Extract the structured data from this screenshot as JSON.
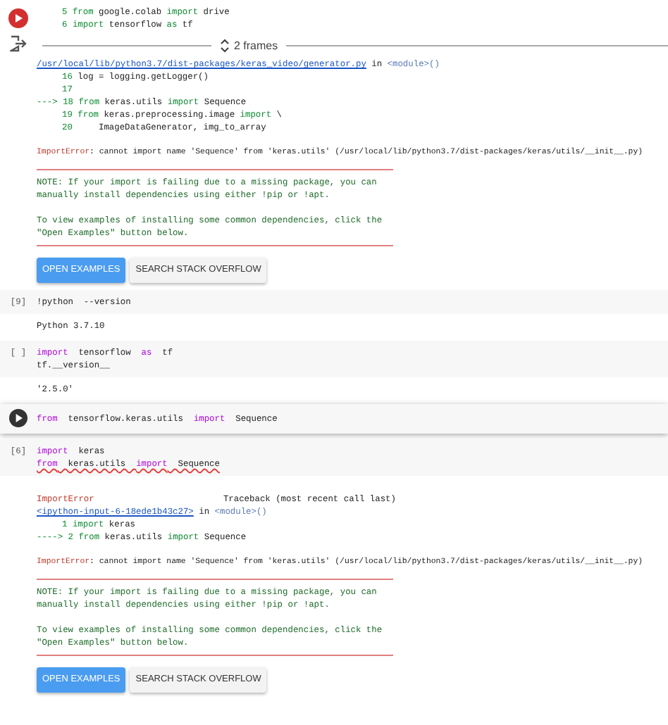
{
  "cells": [
    {
      "kind": "continued",
      "error": true,
      "outputs": [
        {
          "kind": "traceback_lines",
          "lines": [
            {
              "number": "5",
              "tokens": [
                {
                  "text": "from",
                  "kind": "keyword"
                },
                {
                  "text": " google.colab ",
                  "kind": "plain"
                },
                {
                  "text": "import",
                  "kind": "keyword"
                },
                {
                  "text": " drive",
                  "kind": "plain"
                }
              ]
            },
            {
              "number": "6",
              "tokens": [
                {
                  "text": "import",
                  "kind": "keyword"
                },
                {
                  "text": " tensorflow ",
                  "kind": "plain"
                },
                {
                  "text": "as",
                  "kind": "keyword"
                },
                {
                  "text": " tf",
                  "kind": "plain"
                }
              ]
            }
          ]
        },
        {
          "kind": "frames_divider",
          "label": "2 frames"
        },
        {
          "kind": "frame_header",
          "link": "/usr/local/lib/python3.7/dist-packages/keras_video/generator.py",
          "middle": " in ",
          "module": "<module>()"
        },
        {
          "kind": "traceback_lines",
          "lines": [
            {
              "number": "16",
              "tokens": [
                {
                  "text": "log = logging.getLogger()",
                  "kind": "plain"
                }
              ]
            },
            {
              "number": "17"
            },
            {
              "arrow": "--->",
              "number": "18",
              "tokens": [
                {
                  "text": "from",
                  "kind": "keyword"
                },
                {
                  "text": " keras.utils ",
                  "kind": "plain"
                },
                {
                  "text": "import",
                  "kind": "keyword"
                },
                {
                  "text": " Sequence",
                  "kind": "plain"
                }
              ]
            },
            {
              "number": "19",
              "tokens": [
                {
                  "text": "from",
                  "kind": "keyword"
                },
                {
                  "text": " keras.preprocessing.image ",
                  "kind": "plain"
                },
                {
                  "text": "import",
                  "kind": "keyword"
                },
                {
                  "text": " \\",
                  "kind": "plain"
                }
              ]
            },
            {
              "number": "20",
              "tokens": [
                {
                  "text": "    ImageDataGenerator, img_to_array",
                  "kind": "plain"
                }
              ]
            }
          ]
        },
        {
          "kind": "error_line",
          "name": "ImportError",
          "message": ": cannot import name 'Sequence' from 'keras.utils' (/usr/local/lib/python3.7/dist-packages/keras/utils/__init__.py)"
        },
        {
          "kind": "note",
          "paragraphs": [
            [
              "NOTE: If your import is failing due to a missing package, you can",
              "manually install dependencies using either !pip or !apt."
            ],
            [
              "To view examples of installing some common dependencies, click the",
              "\"Open Examples\" button below."
            ]
          ]
        },
        {
          "kind": "buttons",
          "buttons": [
            {
              "label": "OPEN EXAMPLES",
              "kind": "primary"
            },
            {
              "label": "SEARCH STACK OVERFLOW",
              "kind": "secondary"
            }
          ]
        }
      ]
    },
    {
      "kind": "code",
      "prompt": "[9]",
      "focused": false,
      "lines": [
        {
          "underlined": false,
          "tokens": [
            {
              "text": "!python  --version",
              "kind": "plain"
            }
          ]
        }
      ],
      "outputs": [
        {
          "kind": "text",
          "lines": [
            "Python 3.7.10"
          ]
        }
      ]
    },
    {
      "kind": "code",
      "prompt": "[ ]",
      "focused": false,
      "lines": [
        {
          "underlined": false,
          "tokens": [
            {
              "text": "import",
              "kind": "keyword"
            },
            {
              "text": "  tensorflow  ",
              "kind": "plain"
            },
            {
              "text": "as",
              "kind": "keyword"
            },
            {
              "text": "  tf",
              "kind": "plain"
            }
          ]
        },
        {
          "underlined": false,
          "tokens": [
            {
              "text": "tf.__version__",
              "kind": "plain"
            }
          ]
        }
      ],
      "outputs": [
        {
          "kind": "text",
          "lines": [
            "'2.5.0'"
          ]
        }
      ]
    },
    {
      "kind": "code",
      "focused": true,
      "lines": [
        {
          "underlined": false,
          "tokens": [
            {
              "text": "from",
              "kind": "keyword"
            },
            {
              "text": "  tensorflow.keras.utils  ",
              "kind": "plain"
            },
            {
              "text": "import",
              "kind": "keyword"
            },
            {
              "text": "  Sequence",
              "kind": "plain"
            }
          ]
        }
      ]
    },
    {
      "kind": "code",
      "prompt": "[6]",
      "focused": false,
      "lines": [
        {
          "underlined": false,
          "tokens": [
            {
              "text": "import",
              "kind": "keyword"
            },
            {
              "text": "  keras",
              "kind": "plain"
            }
          ]
        },
        {
          "underlined": true,
          "tokens": [
            {
              "text": "from",
              "kind": "keyword"
            },
            {
              "text": "  keras.utils  ",
              "kind": "plain"
            },
            {
              "text": "import",
              "kind": "keyword"
            },
            {
              "text": "  Sequence",
              "kind": "plain"
            }
          ]
        }
      ],
      "outputs": [
        {
          "kind": "traceback_title",
          "name": "ImportError",
          "title": "Traceback (most recent call last)"
        },
        {
          "kind": "frame_header",
          "link": "<ipython-input-6-18ede1b43c27>",
          "middle": " in ",
          "module": "<module>()"
        },
        {
          "kind": "traceback_lines",
          "lines": [
            {
              "number": "1",
              "tokens": [
                {
                  "text": "import",
                  "kind": "keyword"
                },
                {
                  "text": " keras",
                  "kind": "plain"
                }
              ]
            },
            {
              "arrow": "---->",
              "number": "2",
              "tokens": [
                {
                  "text": "from",
                  "kind": "keyword"
                },
                {
                  "text": " keras.utils ",
                  "kind": "plain"
                },
                {
                  "text": "import",
                  "kind": "keyword"
                },
                {
                  "text": " Sequence",
                  "kind": "plain"
                }
              ]
            }
          ]
        },
        {
          "kind": "error_line",
          "name": "ImportError",
          "message": ": cannot import name 'Sequence' from 'keras.utils' (/usr/local/lib/python3.7/dist-packages/keras/utils/__init__.py)"
        },
        {
          "kind": "note",
          "paragraphs": [
            [
              "NOTE: If your import is failing due to a missing package, you can",
              "manually install dependencies using either !pip or !apt."
            ],
            [
              "To view examples of installing some common dependencies, click the",
              "\"Open Examples\" button below."
            ]
          ]
        },
        {
          "kind": "buttons",
          "buttons": [
            {
              "label": "OPEN EXAMPLES",
              "kind": "primary"
            },
            {
              "label": "SEARCH STACK OVERFLOW",
              "kind": "secondary"
            }
          ]
        }
      ]
    }
  ]
}
